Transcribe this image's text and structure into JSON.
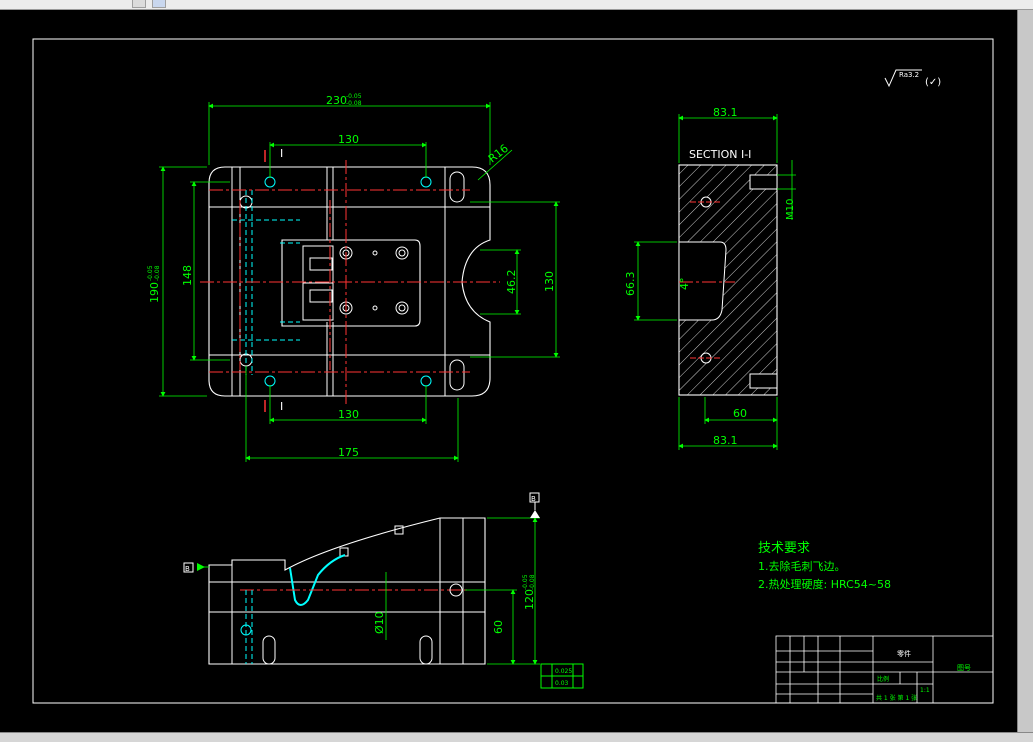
{
  "toolbar": {
    "buttons": [
      "icon-a",
      "icon-b"
    ]
  },
  "colors": {
    "background": "#000000",
    "outline": "#ffffff",
    "dimension": "#00ff00",
    "hidden": "#00ffff",
    "center": "#ff3333",
    "hatch": "#ffffff"
  },
  "plan_view": {
    "overall_width": "230",
    "overall_width_tol_upper": "-0.05",
    "overall_width_tol_lower": "-0.08",
    "hole_spacing_top": "130",
    "hole_spacing_bottom": "130",
    "base_width": "175",
    "overall_height": "190",
    "overall_height_tol_upper": "-0.05",
    "overall_height_tol_lower": "-0.08",
    "inner_height": "148",
    "right_height": "130",
    "slot_height": "46.2",
    "radius": "R16",
    "section_mark_top": "I",
    "section_mark_bottom": "I"
  },
  "section_view": {
    "title": "SECTION I-I",
    "top_width": "83.1",
    "bottom_width": "83.1",
    "inner_width": "60",
    "cut_height": "66.3",
    "angle": "4°",
    "bolt": "M10"
  },
  "front_view": {
    "height": "120",
    "height_tol_upper": "-0.05",
    "height_tol_lower": "-0.08",
    "inner_height": "60",
    "hole_dia": "Ø10",
    "datum_left": "B",
    "datum_top": "B",
    "fcf_row1": "0.025",
    "fcf_row2": "0.03"
  },
  "surface_finish": {
    "value": "Ra3.2",
    "suffix": "(✓)"
  },
  "tech_requirements": {
    "title": "技术要求",
    "items": [
      "1.去除毛刺飞边。",
      "2.热处理硬度: HRC54~58"
    ]
  },
  "title_block": {
    "part_name": "零件",
    "drawing_no": "图号",
    "scale_label": "比例",
    "scale": "1:1",
    "sheet": "共 1 张 第 1 张"
  }
}
